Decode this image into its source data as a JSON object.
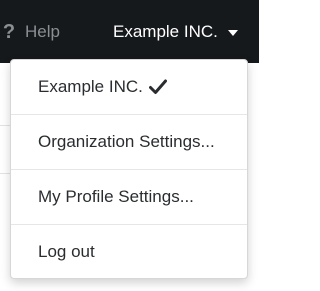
{
  "header": {
    "help_label": "Help",
    "help_icon_glyph": "?",
    "org_label": "Example INC."
  },
  "menu": {
    "items": [
      {
        "label": "Example INC.",
        "selected": true
      },
      {
        "label": "Organization Settings..."
      },
      {
        "label": "My Profile Settings..."
      },
      {
        "label": "Log out"
      }
    ]
  },
  "colors": {
    "topbar_bg": "#16191c",
    "menu_text": "#2a2d30",
    "help_text": "#8a8f94"
  },
  "icons": {
    "help": "help-icon",
    "caret": "caret-down-icon",
    "check": "check-icon"
  }
}
